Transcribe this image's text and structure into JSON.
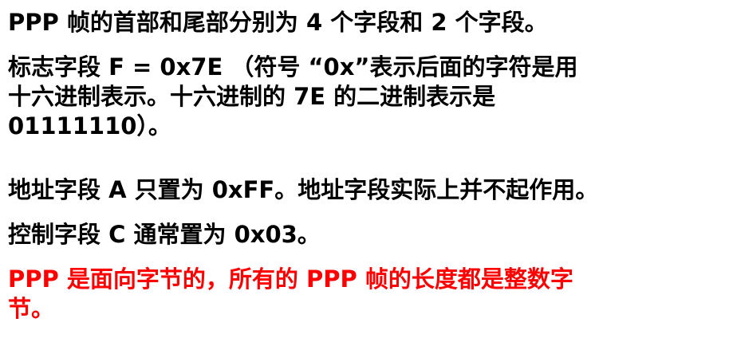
{
  "slide": {
    "paragraphs": [
      {
        "lines": [
          "PPP 帧的首部和尾部分别为 4 个字段和 2 个字段。"
        ]
      },
      {
        "lines": [
          "标志字段 F = 0x7E （符号 “0x”表示后面的字符是用",
          "十六进制表示。十六进制的 7E 的二进制表示是",
          "01111110）。"
        ]
      },
      {
        "lines": [
          "地址字段 A 只置为 0xFF。地址字段实际上并不起作用。"
        ]
      },
      {
        "lines": [
          "控制字段 C 通常置为 0x03。"
        ]
      },
      {
        "lines": [
          "PPP 是面向字节的，所有的 PPP 帧的长度都是整数字",
          "节。"
        ]
      }
    ]
  },
  "colors": {
    "text": "#000000",
    "highlight": "#ff0000"
  }
}
